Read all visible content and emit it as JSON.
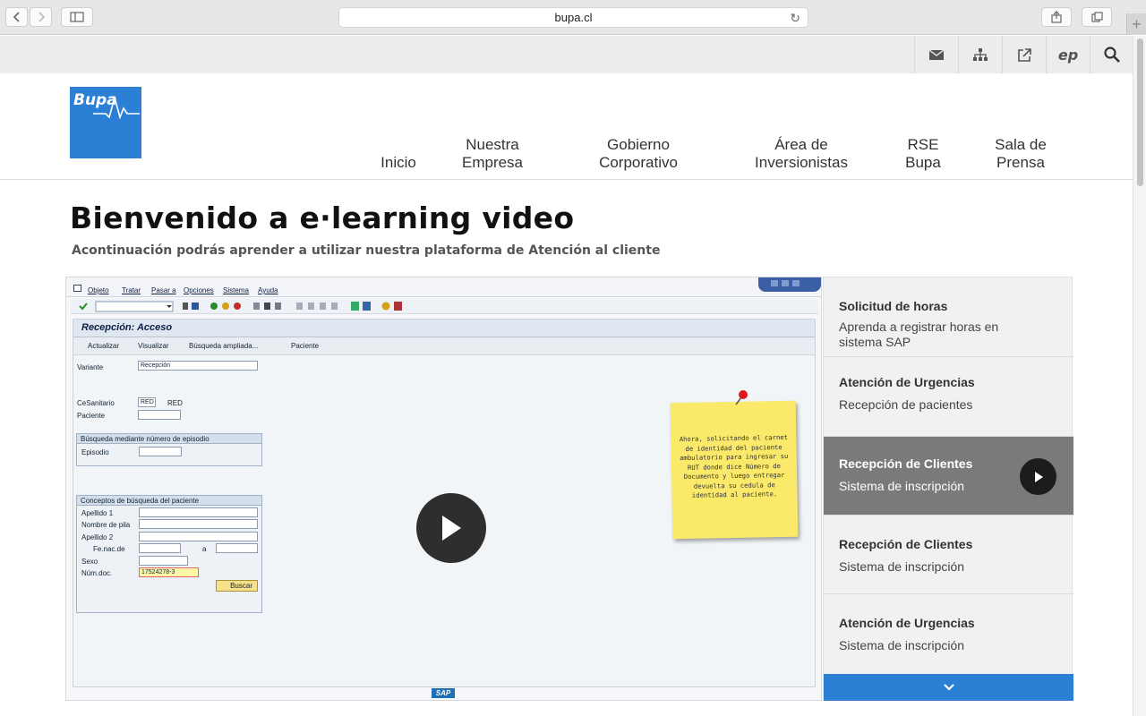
{
  "browser": {
    "url": "bupa.cl",
    "back_icon": "chevron-left-icon",
    "forward_icon": "chevron-right-icon",
    "sidebar_icon": "sidebar-icon",
    "reload_icon": "reload-icon",
    "share_icon": "share-icon",
    "tabs_icon": "tabs-icon",
    "new_tab_icon": "plus-icon"
  },
  "utility_icons": [
    "mail-icon",
    "sitemap-icon",
    "external-link-icon",
    "ep-icon",
    "search-icon"
  ],
  "utility": {
    "ep_label": "ep"
  },
  "brand": {
    "name": "Bupa",
    "color": "#2b7fd4"
  },
  "nav": [
    {
      "line1": "",
      "line2": "Inicio"
    },
    {
      "line1": "Nuestra",
      "line2": "Empresa"
    },
    {
      "line1": "Gobierno",
      "line2": "Corporativo"
    },
    {
      "line1": "Área de",
      "line2": "Inversionistas"
    },
    {
      "line1": "RSE",
      "line2": "Bupa"
    },
    {
      "line1": "Sala de",
      "line2": "Prensa"
    }
  ],
  "page": {
    "title": "Bienvenido a e·learning video",
    "subtitle": "Acontinuación podrás aprender a utilizar nuestra plataforma de Atención al cliente"
  },
  "video": {
    "sap_menu": [
      "Objeto",
      "Tratar",
      "Pasar a",
      "Opciones",
      "Sistema",
      "Ayuda"
    ],
    "screen_title": "Recepción: Acceso",
    "actions": [
      "Actualizar",
      "Visualizar",
      "Búsqueda ampliada...",
      "Paciente"
    ],
    "variante_label": "Variante",
    "variante_value": "Recepción",
    "cesanitario_label": "CeSanitario",
    "cesanitario_value": "RED",
    "cesanitario_text": "RED",
    "paciente_label": "Paciente",
    "episode_group": "Búsqueda mediante número de episodio",
    "episodio_label": "Episodio",
    "concepts_group": "Conceptos de búsqueda del paciente",
    "apellido1_label": "Apellido 1",
    "nombre_label": "Nombre de pila",
    "apellido2_label": "Apellido 2",
    "fenac_label": "Fe.nac.de",
    "fenac_to": "a",
    "sexo_label": "Sexo",
    "numdoc_label": "Núm.doc.",
    "numdoc_value": "17524278-3",
    "buscar_label": "Buscar",
    "note_text": "Ahora, solicitando el carnet de identidad del paciente ambulatorio para ingresar su RUT donde dice Número de Documento y luego entregar devuelta su cedula de identidad al paciente.",
    "sap_logo": "SAP"
  },
  "playlist": [
    {
      "title": "Solicitud de horas",
      "subtitle": "Aprenda  a  registrar horas en sistema SAP",
      "active": false
    },
    {
      "title": "Atención de Urgencias",
      "subtitle": "Recepción de pacientes",
      "active": false
    },
    {
      "title": "Recepción de Clientes",
      "subtitle": "Sistema de inscripción",
      "active": true
    },
    {
      "title": "Recepción de Clientes",
      "subtitle": "Sistema de inscripción",
      "active": false
    },
    {
      "title": "Atención de Urgencias",
      "subtitle": "Sistema de inscripción",
      "active": false
    }
  ],
  "colors": {
    "accent": "#2b7fd4",
    "active_item": "#7a7a7a",
    "note": "#fbe96a"
  }
}
